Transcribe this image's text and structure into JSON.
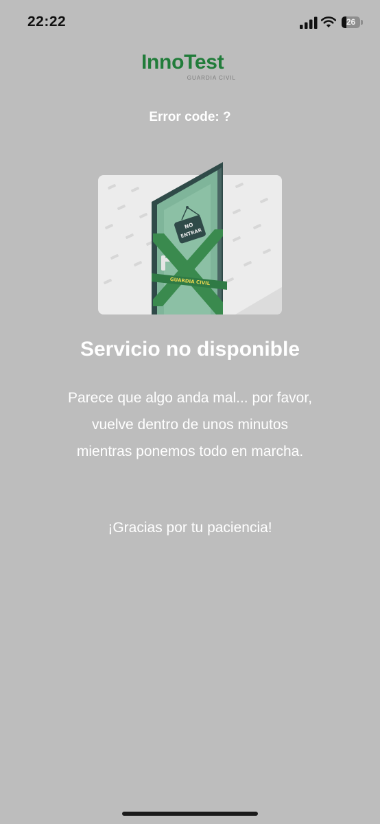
{
  "status_bar": {
    "time": "22:22",
    "battery_level": "26",
    "icons": [
      "signal-icon",
      "wifi-icon",
      "battery-icon"
    ]
  },
  "brand": {
    "name": "InnoTest",
    "subtitle": "GUARDIA CIVIL",
    "color": "#217c3a"
  },
  "error": {
    "label": "Error code: ?"
  },
  "illustration": {
    "sign_line1": "NO",
    "sign_line2": "ENTRAR",
    "tape_text": "GUARDIA CIVIL"
  },
  "main": {
    "title": "Servicio no disponible",
    "message": "Parece que algo anda mal... por favor, vuelve dentro de unos minutos mientras ponemos todo en marcha.",
    "thanks": "¡Gracias por tu paciencia!"
  },
  "colors": {
    "background": "#bdbdbd",
    "text": "#ffffff",
    "door": "#7fb59a",
    "door_frame": "#2f4a48",
    "tape": "#3a8a4e"
  }
}
